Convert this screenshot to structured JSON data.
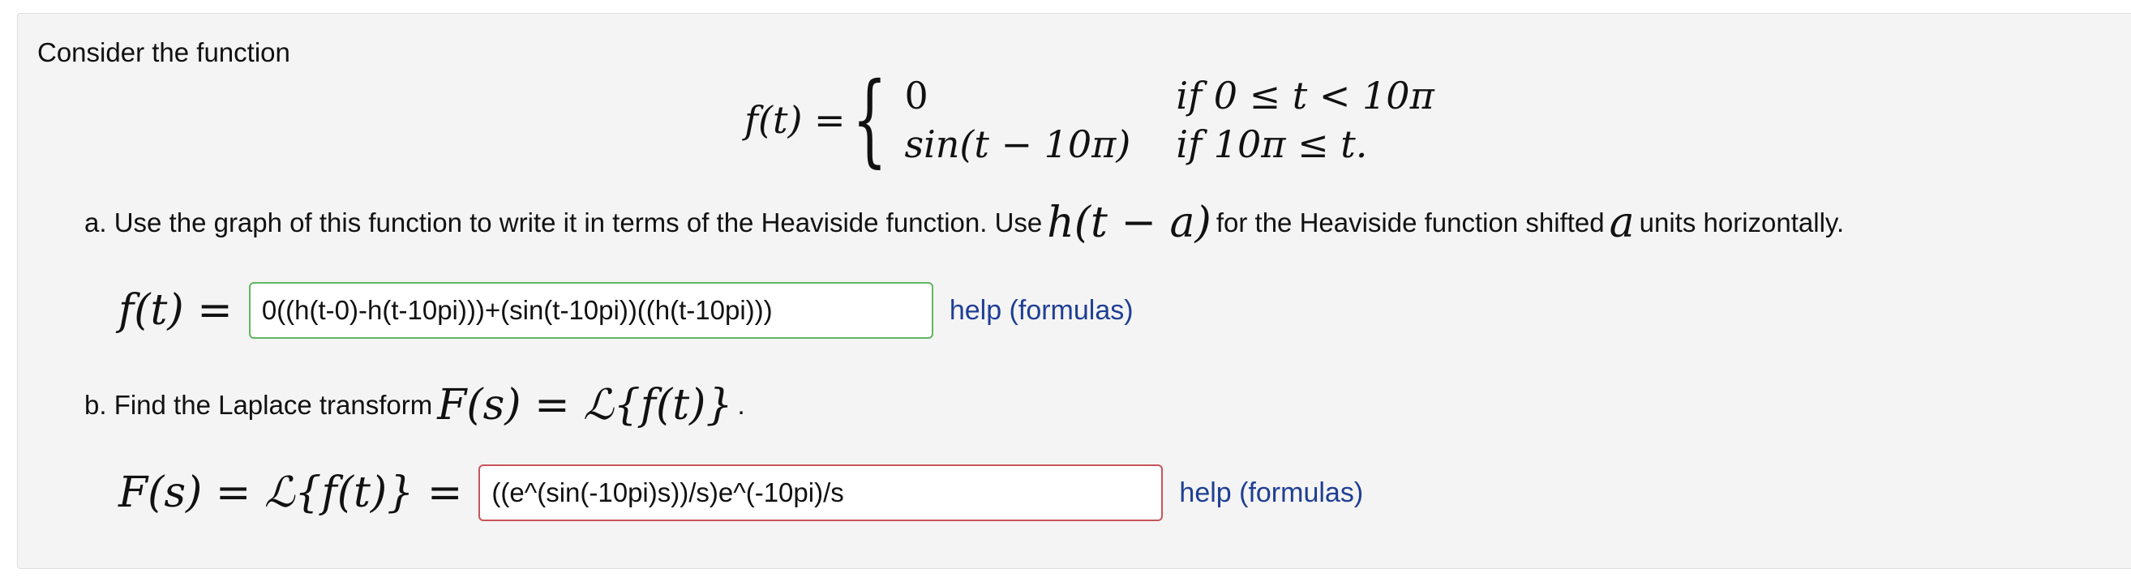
{
  "problem": {
    "intro": "Consider the function",
    "definition": {
      "lhs": "f(t) =",
      "case1_value": "0",
      "case1_cond": "if 0 ≤ t < 10π",
      "case2_value": "sin(t − 10π)",
      "case2_cond": "if 10π ≤ t."
    },
    "part_a": {
      "prefix": "a. Use the graph of this function to write it in terms of the Heaviside function. Use",
      "symbol": "h(t − a)",
      "middle": "for the Heaviside function shifted",
      "var": "a",
      "suffix": "units horizontally.",
      "answer_label": "f(t) =",
      "answer_value": "0((h(t-0)-h(t-10pi)))+(sin(t-10pi))((h(t-10pi)))",
      "answer_status": "correct",
      "help_label": "help (formulas)"
    },
    "part_b": {
      "prefix": "b. Find the Laplace transform",
      "expr": "F(s) = ℒ{f(t)}",
      "suffix": ".",
      "answer_label": "F(s) = ℒ{f(t)} =",
      "answer_value": "((e^(sin(-10pi)s))/s)e^(-10pi)/s",
      "answer_status": "incorrect",
      "help_label": "help (formulas)"
    }
  },
  "colors": {
    "correct_border": "#5fb760",
    "incorrect_border": "#c8545a",
    "link": "#1f3f93",
    "panel_bg": "#f4f4f4"
  }
}
